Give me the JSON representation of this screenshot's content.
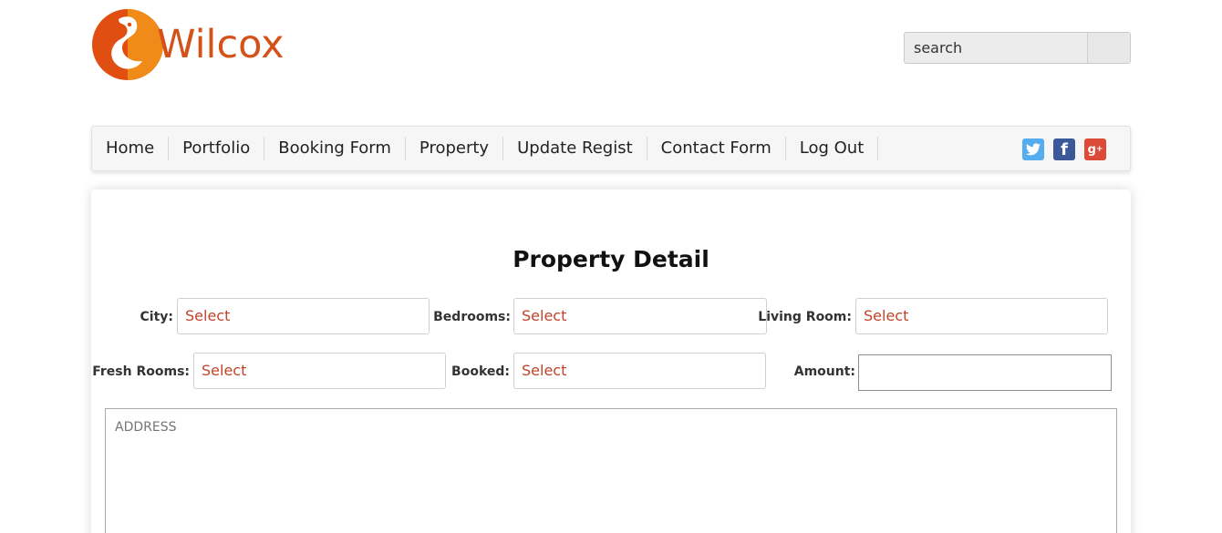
{
  "brand": {
    "name": "Wilcox",
    "color": "#d4521a"
  },
  "search": {
    "placeholder": "search"
  },
  "nav": {
    "items": [
      "Home",
      "Portfolio",
      "Booking Form",
      "Property",
      "Update Regist",
      "Contact Form",
      "Log Out"
    ],
    "social": [
      "twitter-icon",
      "facebook-icon",
      "google-plus-icon"
    ]
  },
  "page": {
    "title": "Property Detail"
  },
  "form": {
    "city": {
      "label": "City:",
      "value": "Select"
    },
    "bedrooms": {
      "label": "Bedrooms:",
      "value": "Select"
    },
    "living_room": {
      "label": "Living Room:",
      "value": "Select"
    },
    "fresh_rooms": {
      "label": "Fresh Rooms:",
      "value": "Select"
    },
    "booked": {
      "label": "Booked:",
      "value": "Select"
    },
    "amount": {
      "label": "Amount:",
      "value": ""
    },
    "address": {
      "placeholder": "ADDRESS"
    }
  },
  "colors": {
    "accent": "#c0442a",
    "twitter": "#55acee",
    "facebook": "#3b5998",
    "google": "#dc4a38"
  }
}
